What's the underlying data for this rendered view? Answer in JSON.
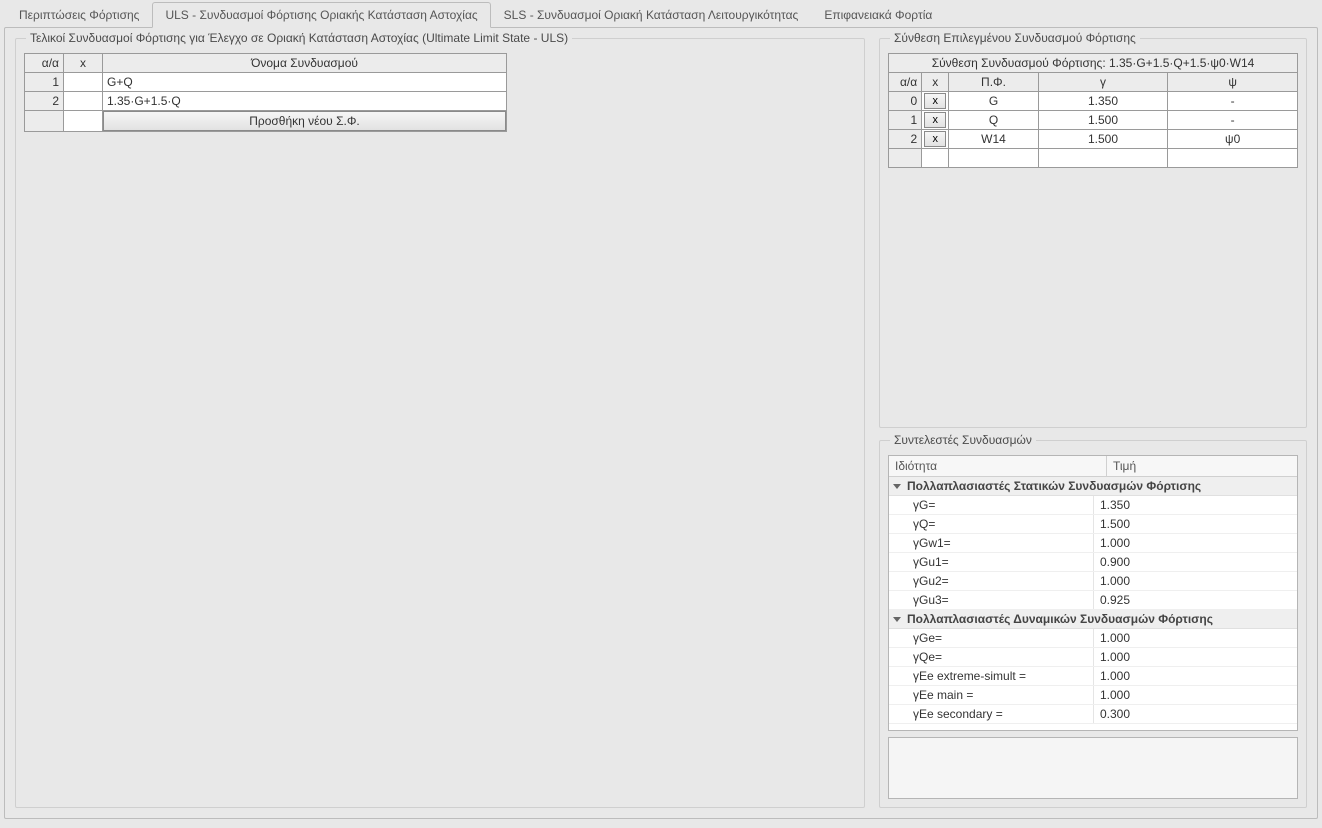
{
  "tabs": {
    "t0": "Περιπτώσεις Φόρτισης",
    "t1": "ULS - Συνδυασμοί Φόρτισης Οριακής Κατάσταση Αστοχίας",
    "t2": "SLS - Συνδυασμοί Οριακή Κατάσταση Λειτουργικότητας",
    "t3": "Επιφανειακά Φορτία"
  },
  "leftGroupTitle": "Τελικοί Συνδυασμοί Φόρτισης για Έλεγχο σε Οριακή Κατάσταση Αστοχίας (Ultimate Limit State - ULS)",
  "leftTable": {
    "h_idx": "α/α",
    "h_x": "x",
    "h_name": "Όνομα Συνδυασμού",
    "r1_idx": "1",
    "r1_name": "G+Q",
    "r2_idx": "2",
    "r2_name": "1.35·G+1.5·Q",
    "addLabel": "Προσθήκη νέου Σ.Φ."
  },
  "rightTopTitle": "Σύνθεση Επιλεγμένου Συνδυασμού Φόρτισης",
  "compTable": {
    "title": "Σύνθεση Συνδυασμού Φόρτισης: 1.35·G+1.5·Q+1.5·ψ0·W14",
    "h_idx": "α/α",
    "h_x": "x",
    "h_pf": "Π.Φ.",
    "h_g": "γ",
    "h_psi": "ψ",
    "xLabel": "x",
    "rows": [
      {
        "idx": "0",
        "pf": "G",
        "g": "1.350",
        "psi": "-"
      },
      {
        "idx": "1",
        "pf": "Q",
        "g": "1.500",
        "psi": "-"
      },
      {
        "idx": "2",
        "pf": "W14",
        "g": "1.500",
        "psi": "ψ0"
      }
    ]
  },
  "coefTitle": "Συντελεστές Συνδυασμών",
  "propHeader": {
    "prop": "Ιδιότητα",
    "val": "Τιμή"
  },
  "group1": "Πολλαπλασιαστές Στατικών Συνδυασμών Φόρτισης",
  "group2": "Πολλαπλασιαστές Δυναμικών Συνδυασμών Φόρτισης",
  "coef": {
    "gG": {
      "k": "γG=",
      "v": "1.350"
    },
    "gQ": {
      "k": "γQ=",
      "v": "1.500"
    },
    "gGw1": {
      "k": "γGw1=",
      "v": "1.000"
    },
    "gGu1": {
      "k": "γGu1=",
      "v": "0.900"
    },
    "gGu2": {
      "k": "γGu2=",
      "v": "1.000"
    },
    "gGu3": {
      "k": "γGu3=",
      "v": "0.925"
    },
    "gGe": {
      "k": "γGe=",
      "v": "1.000"
    },
    "gQe": {
      "k": "γQe=",
      "v": "1.000"
    },
    "gEeex": {
      "k": "γEe extreme-simult =",
      "v": "1.000"
    },
    "gEemain": {
      "k": "γEe main =",
      "v": "1.000"
    },
    "gEesec": {
      "k": "γEe secondary =",
      "v": "0.300"
    }
  }
}
